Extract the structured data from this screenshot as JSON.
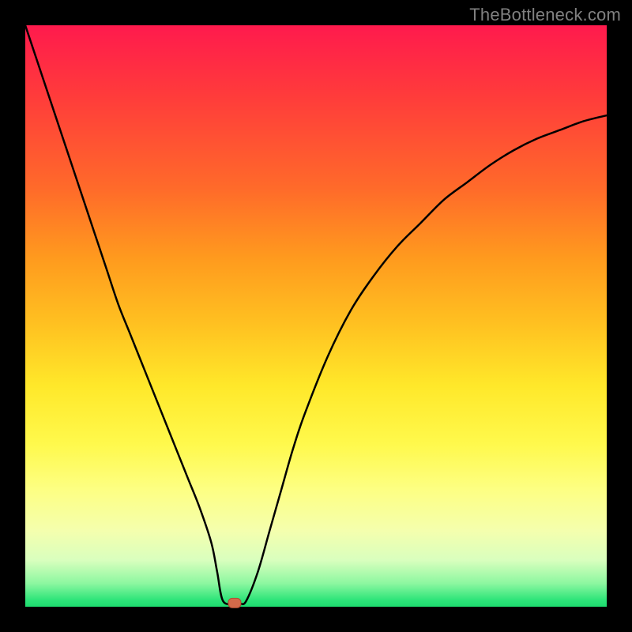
{
  "watermark": "TheBottleneck.com",
  "colors": {
    "frame": "#000000",
    "gradient_top": "#ff1a4d",
    "gradient_mid": "#ffe82a",
    "gradient_bottom": "#1ddc6f",
    "curve": "#000000",
    "marker": "#d46a4a"
  },
  "chart_data": {
    "type": "line",
    "title": "",
    "xlabel": "",
    "ylabel": "",
    "xlim": [
      0,
      100
    ],
    "ylim": [
      0,
      100
    ],
    "grid": false,
    "legend": false,
    "series": [
      {
        "name": "bottleneck-curve",
        "x": [
          0,
          2,
          4,
          6,
          8,
          10,
          12,
          14,
          16,
          18,
          20,
          22,
          24,
          26,
          28,
          30,
          32,
          33,
          34,
          36,
          37,
          38,
          40,
          42,
          44,
          46,
          48,
          52,
          56,
          60,
          64,
          68,
          72,
          76,
          80,
          84,
          88,
          92,
          96,
          100
        ],
        "y": [
          100,
          94,
          88,
          82,
          76,
          70,
          64,
          58,
          52,
          47,
          42,
          37,
          32,
          27,
          22,
          17,
          11,
          6,
          1,
          0.5,
          0.5,
          1,
          6,
          13,
          20,
          27,
          33,
          43,
          51,
          57,
          62,
          66,
          70,
          73,
          76,
          78.5,
          80.5,
          82,
          83.5,
          84.5
        ]
      }
    ],
    "marker": {
      "x": 36,
      "y": 0.5
    }
  }
}
